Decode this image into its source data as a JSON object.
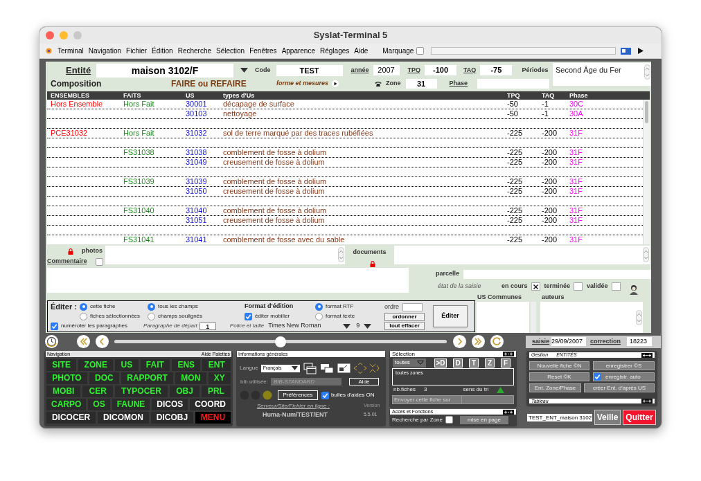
{
  "window": {
    "title": "Syslat-Terminal 5"
  },
  "menu": {
    "items": [
      "Terminal",
      "Navigation",
      "Fichier",
      "Édition",
      "Recherche",
      "Sélection",
      "Fenêtres",
      "Apparence",
      "Réglages",
      "Aide"
    ],
    "marquage": {
      "label": "Marquage",
      "checked": false
    }
  },
  "entity": {
    "label": "Entité",
    "name": "maison 3102/F",
    "composition": "Composition",
    "faire": "FAIRE ou REFAIRE",
    "code_label": "Code",
    "code": "TEST",
    "annee_label": "année",
    "annee": "2007",
    "tpq_label": "TPQ",
    "tpq": "-100",
    "taq_label": "TAQ",
    "taq": "-75",
    "periodes_label": "Périodes",
    "periodes": "Second Âge du Fer",
    "forme": "forme et mesures",
    "zone_label": "Zone",
    "zone": "31",
    "phase_label": "Phase"
  },
  "table": {
    "columns": [
      "ENSEMBLES",
      "FAITS",
      "US",
      "types d'Us",
      "TPQ",
      "TAQ",
      "Phase"
    ],
    "rows": [
      {
        "kind": "entry",
        "ensemble": "Hors Ensemble",
        "fait": "Hors Fait",
        "us": "30001",
        "type": "décapage de surface",
        "tpq": "-50",
        "taq": "-1",
        "phase": "30C"
      },
      {
        "kind": "entry",
        "us": "30103",
        "type": "nettoyage",
        "tpq": "-50",
        "taq": "-1",
        "phase": "30A"
      },
      {
        "kind": "spacer"
      },
      {
        "kind": "entry",
        "ensemble": "PCE31032",
        "fait": "Hors Fait",
        "us": "31032",
        "type": "sol de terre marqué par des traces rubéfiées",
        "tpq": "-225",
        "taq": "-200",
        "phase": "31F"
      },
      {
        "kind": "spacer"
      },
      {
        "kind": "entry",
        "fait": "FS31038",
        "us": "31038",
        "type": "comblement de fosse à dolium",
        "tpq": "-225",
        "taq": "-200",
        "phase": "31F"
      },
      {
        "kind": "entry",
        "us": "31049",
        "type": "creusement de fosse à dolium",
        "tpq": "-225",
        "taq": "-200",
        "phase": "31F"
      },
      {
        "kind": "spacer"
      },
      {
        "kind": "entry",
        "fait": "FS31039",
        "us": "31039",
        "type": "comblement de fosse à dolium",
        "tpq": "-225",
        "taq": "-200",
        "phase": "31F"
      },
      {
        "kind": "entry",
        "us": "31050",
        "type": "creusement de fosse à dolium",
        "tpq": "-225",
        "taq": "-200",
        "phase": "31F"
      },
      {
        "kind": "spacer"
      },
      {
        "kind": "entry",
        "fait": "FS31040",
        "us": "31040",
        "type": "comblement de fosse à dolium",
        "tpq": "-225",
        "taq": "-200",
        "phase": "31F"
      },
      {
        "kind": "entry",
        "us": "31051",
        "type": "creusement de fosse à dolium",
        "tpq": "-225",
        "taq": "-200",
        "phase": "31F"
      },
      {
        "kind": "spacer"
      },
      {
        "kind": "entry",
        "fait": "FS31041",
        "us": "31041",
        "type": "comblement de fosse avec du sable",
        "tpq": "-225",
        "taq": "-200",
        "phase": "31F"
      }
    ]
  },
  "notes": {
    "photos_label": "photos",
    "documents_label": "documents",
    "commentaire_label": "Commentaire",
    "commentaire_checked": false,
    "parcelle_label": "parcelle",
    "etat_label": "état de la saisie",
    "etats": [
      {
        "label": "en cours",
        "checked": true
      },
      {
        "label": "terminée",
        "checked": false
      },
      {
        "label": "validée",
        "checked": false
      }
    ],
    "us_communes_label": "US Communes",
    "auteurs_label": "auteurs"
  },
  "editer": {
    "label": "Éditer :",
    "scope": [
      {
        "label": "cette fiche",
        "selected": true
      },
      {
        "label": "fiches sélectionnées",
        "selected": false
      }
    ],
    "fields": [
      {
        "label": "tous les champs",
        "selected": true
      },
      {
        "label": "champs soulignés",
        "selected": false
      }
    ],
    "format_title": "Format d'édition",
    "mobilier": {
      "label": "éditer mobilier",
      "checked": true
    },
    "formats": [
      {
        "label": "format RTF",
        "selected": true
      },
      {
        "label": "format texte",
        "selected": false
      }
    ],
    "numeroter": {
      "label": "numéroter les paragraphes",
      "checked": true
    },
    "paragraphe_label": "Paragraphe de départ",
    "paragraphe": "1",
    "police_label": "Police et taille",
    "police": "Times New Roman",
    "taille": "9",
    "ordre_label": "ordre",
    "ordonner": "ordonner",
    "effacer": "tout effacer",
    "button": "Éditer"
  },
  "navbar": {
    "level": 0.5,
    "saisie_label": "saisie",
    "saisie": "29/09/2007",
    "correction_label": "correction",
    "correction": "18223"
  },
  "navigation": {
    "title": "Navigation",
    "help": "Aide Palettes",
    "groups": [
      {
        "buttons": [
          {
            "label": "SITE",
            "kind": "module"
          },
          {
            "label": "ZONE",
            "kind": "module"
          },
          {
            "label": "US",
            "kind": "module"
          },
          {
            "label": "FAIT",
            "kind": "module"
          },
          {
            "label": "ENS",
            "kind": "module"
          },
          {
            "label": "ENT",
            "kind": "module"
          }
        ]
      },
      {
        "buttons": [
          {
            "label": "PHOTO",
            "kind": "module"
          },
          {
            "label": "DOC",
            "kind": "module"
          },
          {
            "label": "RAPPORT",
            "kind": "module"
          },
          {
            "label": "MON",
            "kind": "module"
          },
          {
            "label": "XY",
            "kind": "module"
          }
        ]
      },
      {
        "buttons": [
          {
            "label": "MOBI",
            "kind": "module"
          },
          {
            "label": "CER",
            "kind": "module"
          },
          {
            "label": "TYPOCER",
            "kind": "module"
          },
          {
            "label": "OBJ",
            "kind": "module"
          },
          {
            "label": "PRL",
            "kind": "module"
          }
        ]
      },
      {
        "buttons": [
          {
            "label": "CARPO",
            "kind": "module"
          },
          {
            "label": "OS",
            "kind": "module"
          },
          {
            "label": "FAUNE",
            "kind": "module"
          },
          {
            "label": "DICOS",
            "kind": "dico"
          },
          {
            "label": "COORD",
            "kind": "dico"
          }
        ]
      },
      {
        "buttons": [
          {
            "label": "DICOCER",
            "kind": "dico"
          },
          {
            "label": "DICOMON",
            "kind": "dico"
          },
          {
            "label": "DICOBJ",
            "kind": "dico"
          },
          {
            "label": "MENU",
            "kind": "menu"
          }
        ]
      }
    ]
  },
  "infos": {
    "title": "Informations générales",
    "langue_label": "Langue",
    "langue": "Français",
    "bib_label": "bib.utilisée:",
    "bib": "BIB-STANDARD",
    "aide": "Aide",
    "preferences": "Préférences",
    "bulles": {
      "label": "bulles d'aides ON",
      "checked": true
    },
    "serveur": "Serveur/Site/Fichier en ligne :",
    "version_label": "Version",
    "server": "Huma-Num/TEST/ENT",
    "version": "5.5.01"
  },
  "selection": {
    "title": "Sélection",
    "filter": "toutes",
    "buttons": [
      ">D",
      "D",
      "T",
      "Z",
      "F"
    ],
    "list": [
      "toutes zones"
    ],
    "nb_label": "nb.fiches",
    "nb": "3",
    "tri_label": "sens du tri",
    "envoyer": "Envoyer cette fiche sur"
  },
  "acces": {
    "title": "Accès et Fonctions",
    "recherche": {
      "label": "Recherche par Zone",
      "checked": false
    },
    "mise": "mise en page"
  },
  "gestion": {
    "title": "Gestion",
    "entity": "ENTITÉS",
    "nouvelle": "Nouvelle fiche ©N",
    "enregistrer": "enregistrer ©S",
    "reset": "Reset ©K",
    "auto": {
      "label": "enregistr. auto",
      "checked": true
    },
    "zone_phase": "Ent. Zone/Phase",
    "creer": "créer Ent. d'après US",
    "tableau": "Tableau"
  },
  "footer": {
    "file": "TEST_ENT_maison 3102",
    "veille": "Veille",
    "quitter": "Quitter"
  }
}
